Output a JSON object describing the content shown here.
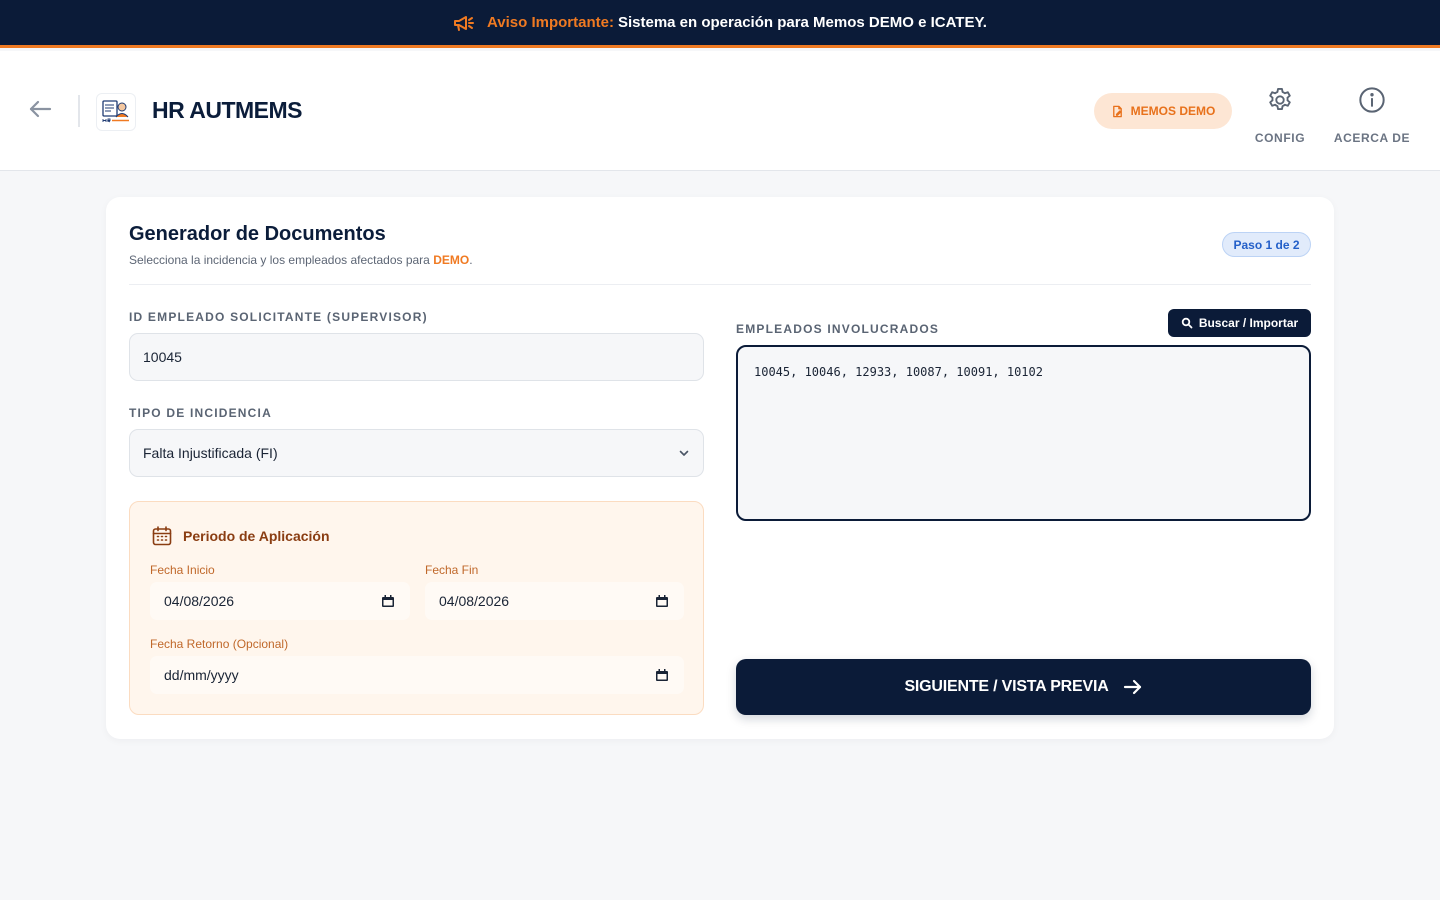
{
  "announcement": {
    "icon": "megaphone-icon",
    "label": "Aviso Importante:",
    "message": "Sistema en operación para Memos DEMO e ICATEY."
  },
  "header": {
    "back_icon": "arrow-left-icon",
    "logo_icon": "hr-autmems-logo",
    "app_title": "HR AUTMEMS",
    "memos_button": "MEMOS DEMO",
    "nav": {
      "config_label": "CONFIG",
      "about_label": "ACERCA DE"
    }
  },
  "form": {
    "title": "Generador de Documentos",
    "subtitle_prefix": "Selecciona la incidencia y los empleados afectados para ",
    "subtitle_highlight": "DEMO",
    "subtitle_suffix": ".",
    "step_badge": "Paso 1 de 2",
    "supervisor": {
      "label": "ID EMPLEADO SOLICITANTE (SUPERVISOR)",
      "value": "10045"
    },
    "incidence": {
      "label": "TIPO DE INCIDENCIA",
      "selected": "Falta Injustificada (FI)"
    },
    "period": {
      "title": "Periodo de Aplicación",
      "start_label": "Fecha Inicio",
      "start_value": "04/08/2026",
      "end_label": "Fecha Fin",
      "end_value": "04/08/2026",
      "return_label": "Fecha Retorno (Opcional)",
      "return_placeholder": "dd/mm/yyyy"
    },
    "employees": {
      "label": "EMPLEADOS INVOLUCRADOS",
      "import_button": "Buscar / Importar",
      "value": "10045, 10046, 12933, 10087, 10091, 10102"
    },
    "next_button": "SIGUIENTE / VISTA PREVIA"
  },
  "colors": {
    "navy": "#0b1b38",
    "accent_orange": "#f07a22",
    "badge_blue": "#2460c9"
  }
}
